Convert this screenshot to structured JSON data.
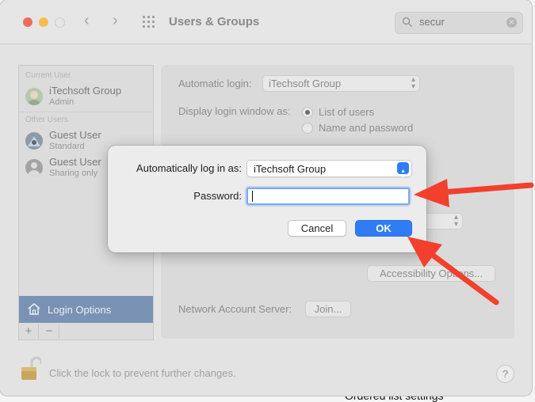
{
  "window": {
    "title": "Users & Groups",
    "traffic_lights": {
      "close": "#ee6a5f",
      "minimize": "#f5be4f",
      "zoom": "#e6e6e6"
    },
    "search": {
      "value": "secur"
    }
  },
  "sidebar": {
    "current_user_header": "Current User",
    "other_users_header": "Other Users",
    "users": [
      {
        "name": "iTechsoft Group",
        "role": "Admin"
      },
      {
        "name": "Guest User",
        "role": "Standard"
      },
      {
        "name": "Guest User",
        "role": "Sharing only"
      }
    ],
    "login_options": "Login Options",
    "add_label": "+",
    "remove_label": "−"
  },
  "main": {
    "automatic_login_label": "Automatic login:",
    "automatic_login_value": "iTechsoft Group",
    "display_login_label": "Display login window as:",
    "radio_list": "List of users",
    "radio_name": "Name and password",
    "accessibility_button": "Accessibility Options...",
    "network_label": "Network Account Server:",
    "join_button": "Join..."
  },
  "footer": {
    "lock_text": "Click the lock to prevent further changes.",
    "help": "?"
  },
  "dialog": {
    "auto_login_label": "Automatically log in as:",
    "auto_login_value": "iTechsoft Group",
    "password_label": "Password:",
    "password_value": "",
    "cancel": "Cancel",
    "ok": "OK"
  },
  "background": {
    "bottom_text": "Ordered list settings"
  },
  "colors": {
    "accent": "#2f7cf6",
    "arrow": "#f2402c",
    "sidebar_selected": "#7a93b4"
  }
}
